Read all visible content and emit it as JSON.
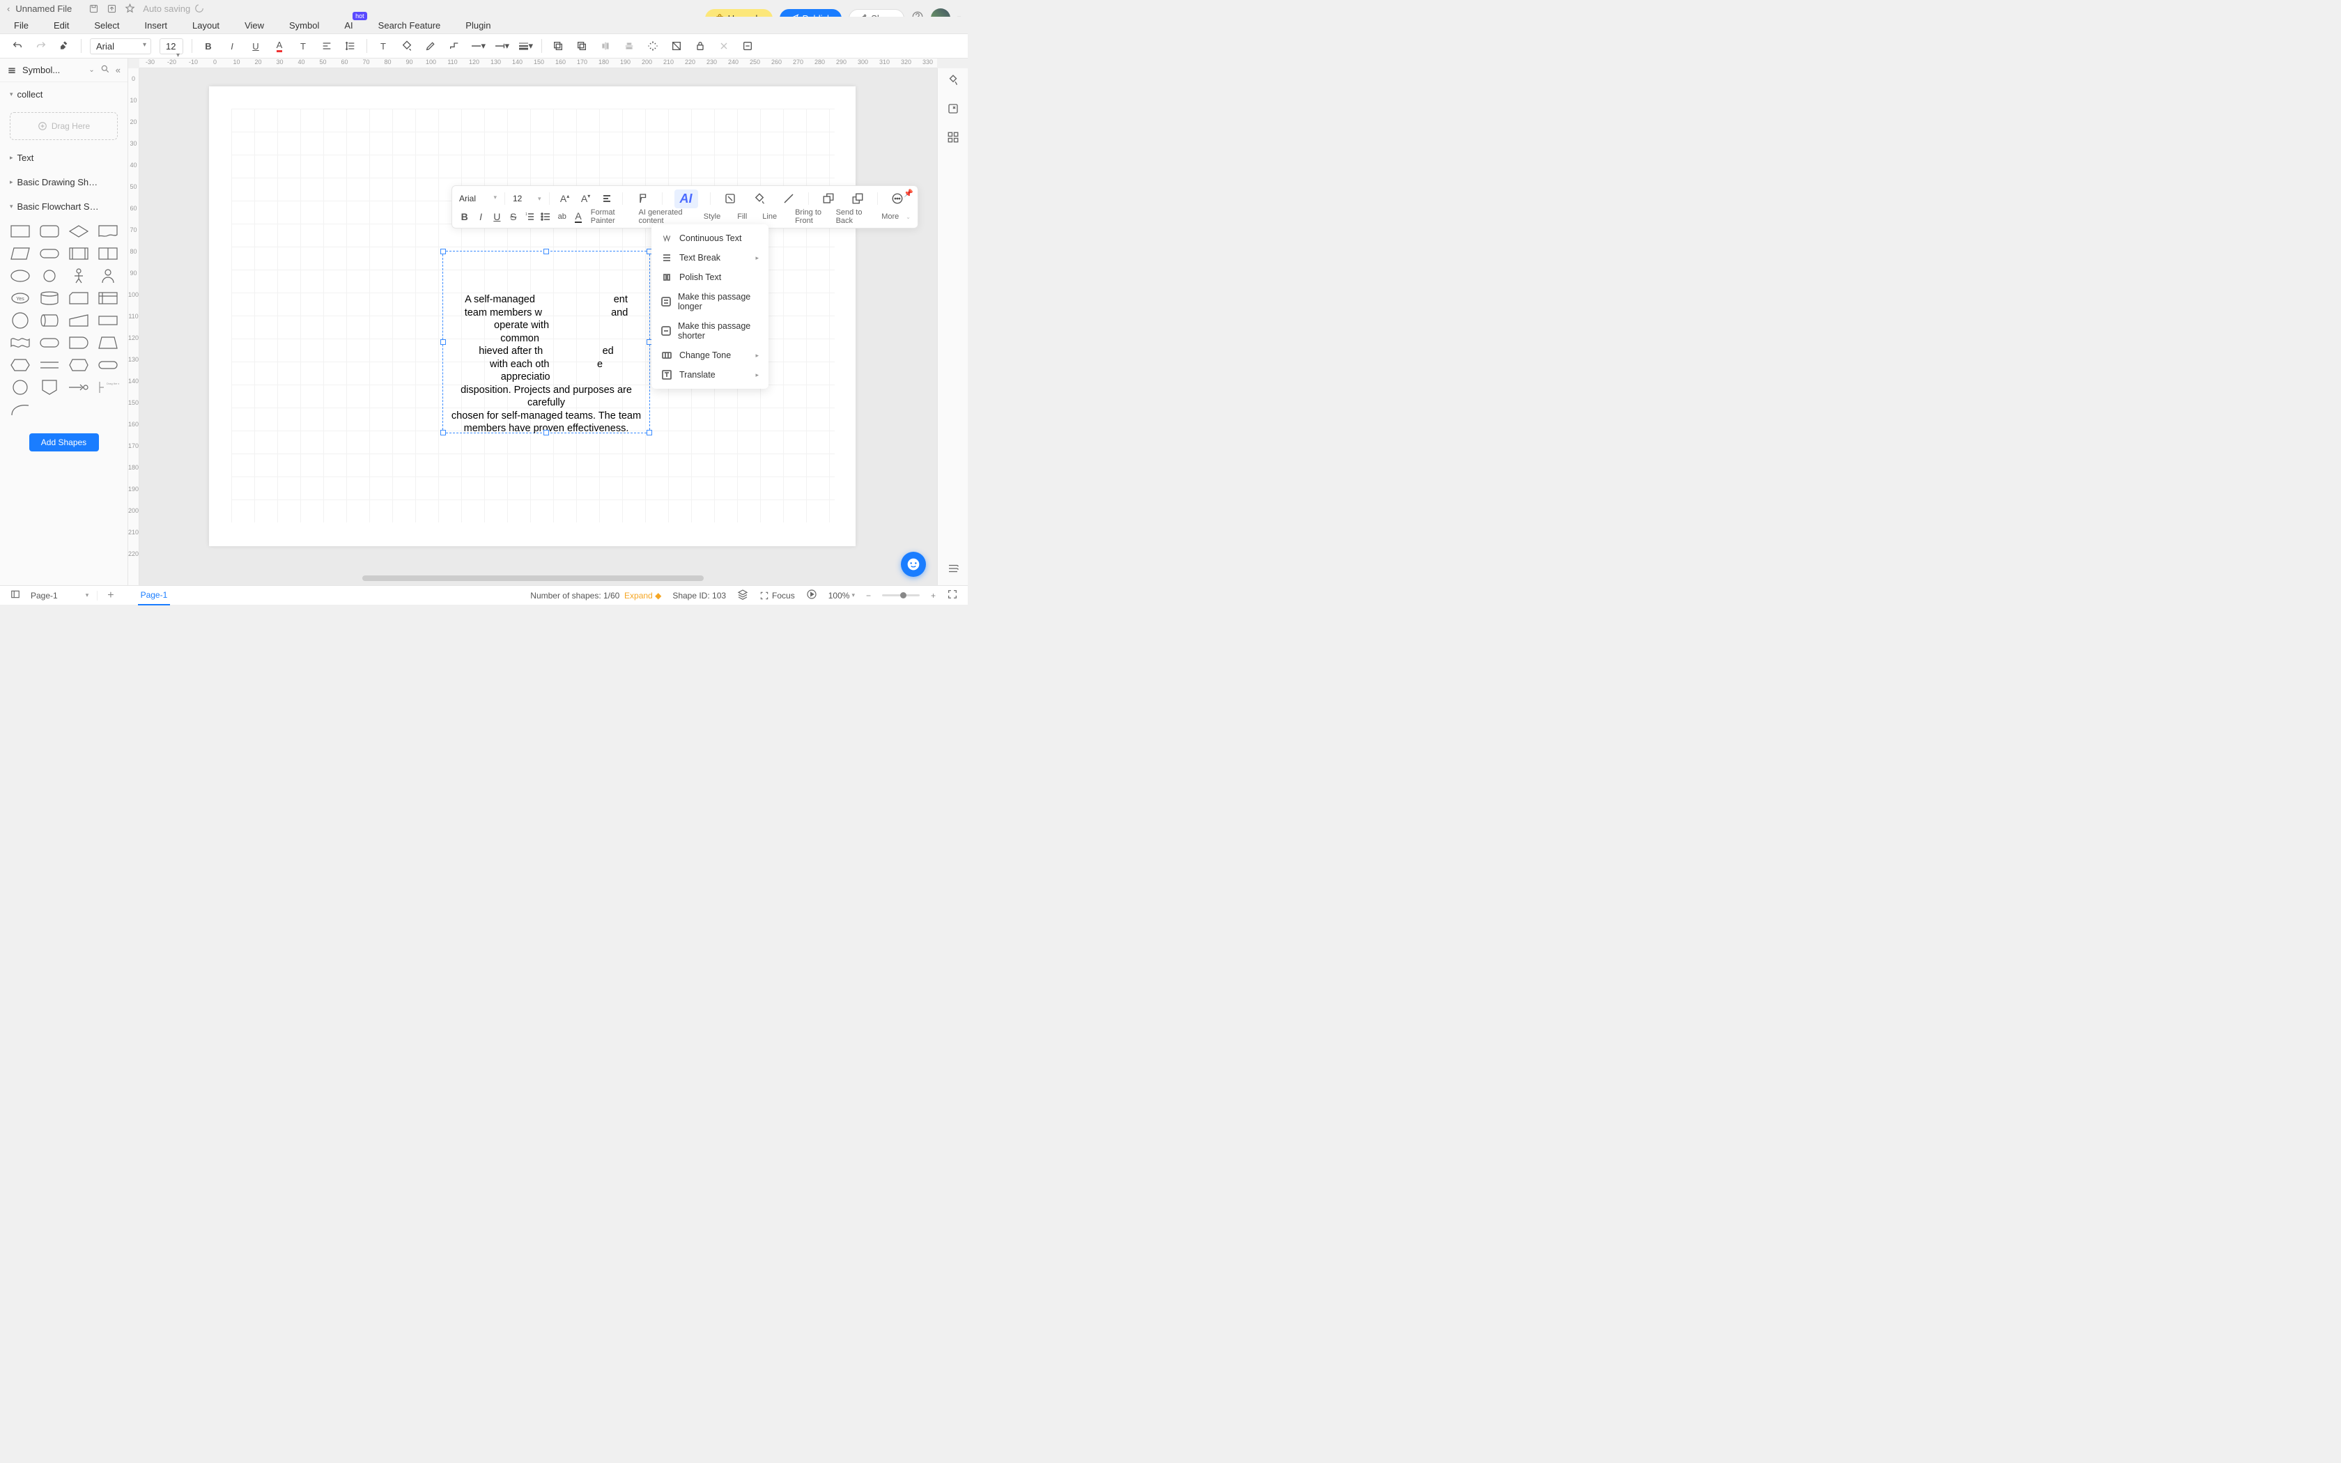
{
  "title": {
    "filename": "Unnamed File",
    "autosave": "Auto saving"
  },
  "topButtons": {
    "upgrade": "Upgrade",
    "publish": "Publish",
    "share": "Share"
  },
  "menu": {
    "file": "File",
    "edit": "Edit",
    "select": "Select",
    "insert": "Insert",
    "layout": "Layout",
    "view": "View",
    "symbol": "Symbol",
    "ai": "AI",
    "hot": "hot",
    "search": "Search Feature",
    "plugin": "Plugin"
  },
  "toolbar": {
    "font": "Arial",
    "size": "12"
  },
  "ruler_h": [
    "-30",
    "-20",
    "-10",
    "0",
    "10",
    "20",
    "30",
    "40",
    "50",
    "60",
    "70",
    "80",
    "90",
    "100",
    "110",
    "120",
    "130",
    "140",
    "150",
    "160",
    "170",
    "180",
    "190",
    "200",
    "210",
    "220",
    "230",
    "240",
    "250",
    "260",
    "270",
    "280",
    "290",
    "300",
    "310",
    "320",
    "330"
  ],
  "ruler_v": [
    "0",
    "10",
    "20",
    "30",
    "40",
    "50",
    "60",
    "70",
    "80",
    "90",
    "100",
    "110",
    "120",
    "130",
    "140",
    "150",
    "160",
    "170",
    "180",
    "190",
    "200",
    "210",
    "220"
  ],
  "sidebar": {
    "title": "Symbol...",
    "collect": "collect",
    "drag": "Drag Here",
    "text": "Text",
    "basic_drawing": "Basic Drawing Sh…",
    "basic_flowchart": "Basic Flowchart S…",
    "add_shapes": "Add Shapes"
  },
  "float_tb": {
    "font": "Arial",
    "size": "12",
    "format_painter": "Format Painter",
    "ai_label": "AI generated content",
    "style": "Style",
    "fill": "Fill",
    "line": "Line",
    "bring_front": "Bring to Front",
    "send_back": "Send to Back",
    "more": "More"
  },
  "ai_menu": {
    "continuous": "Continuous Text",
    "text_break": "Text Break",
    "polish": "Polish Text",
    "longer": "Make this passage longer",
    "shorter": "Make this passage shorter",
    "tone": "Change Tone",
    "translate": "Translate"
  },
  "text_block": "A self-managed\nteam members w\noperate with\ncommon\nhieved after th\nwith each oth\nappreciatio\ndisposition. Projects and purposes are carefully\nchosen for self-managed teams. The team\nmembers have proven effectiveness.",
  "text_block_right": "ent\nand\n\n\ned\ne",
  "bottom": {
    "page": "Page-1",
    "tab": "Page-1",
    "shapes": "Number of shapes: 1/60",
    "expand": "Expand",
    "shape_id": "Shape ID: 103",
    "focus": "Focus",
    "zoom": "100%"
  }
}
